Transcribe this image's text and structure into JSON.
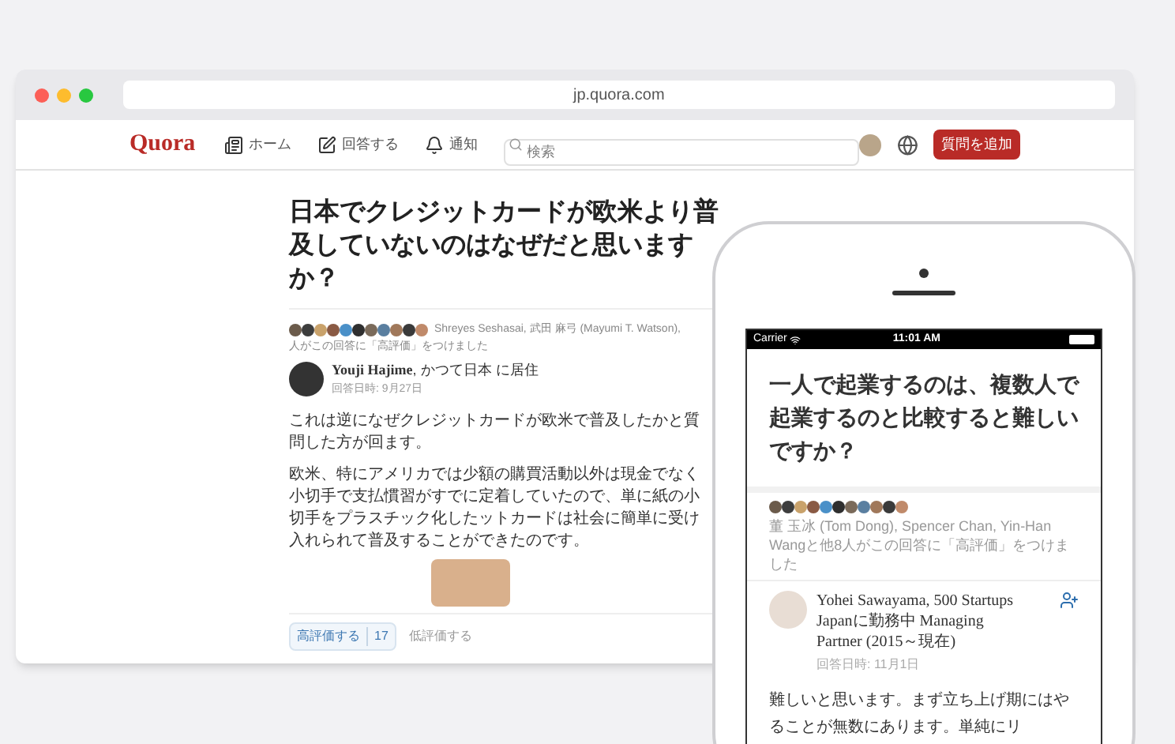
{
  "browser": {
    "url": "jp.quora.com"
  },
  "nav": {
    "logo": "Quora",
    "items": [
      {
        "kind": "home",
        "label": "ホーム"
      },
      {
        "kind": "answer",
        "label": "回答する"
      },
      {
        "kind": "notifications",
        "label": "通知"
      }
    ],
    "search": {
      "placeholder": "検索"
    },
    "add_button": "質問を追加"
  },
  "article": {
    "title": "日本でクレジットカードが欧米より普及していないのはなぜだと思いますか？",
    "upvoters": {
      "names": "Shreyes Seshasai, 武田 麻弓 (Mayumi T. Watson),",
      "suffix": "人がこの回答に「高評価」をつけました"
    },
    "author": {
      "name": "Youji Hajime",
      "credential": ", かつて日本 に居住",
      "date": "回答日時: 9月27日"
    },
    "paragraphs": [
      "これは逆になぜクレジットカードが欧米で普及したかと質問した方が回",
      "ます。",
      "欧米、特にアメリカでは少額の購買活動以外は現金でなく小切手で支払",
      "慣習がすでに定着していたので、単に紙の小切手をプラスチック化した",
      "ットカードは社会に簡単に受け入れられて普及することができたのです。"
    ],
    "upvote": {
      "label": "高評価する",
      "count": "17"
    },
    "downvote": "低評価する"
  },
  "phone": {
    "status": {
      "carrier": "Carrier",
      "time": "11:01 AM"
    },
    "title": "一人で起業するのは、複数人で起業するのと比較すると難しいですか？",
    "upvoters": {
      "text": "董 玉冰 (Tom Dong), Spencer Chan, Yin-Han Wangと他8人がこの回答に「高評価」をつけました"
    },
    "author": {
      "name": "Yohei Sawayama, 500 Startups Japanに勤務中 Managing Partner (2015～現在)",
      "date": "回答日時: 11月1日"
    },
    "body": "難しいと思います。まず立ち上げ期にはやることが無数にあります。単純にリ"
  }
}
